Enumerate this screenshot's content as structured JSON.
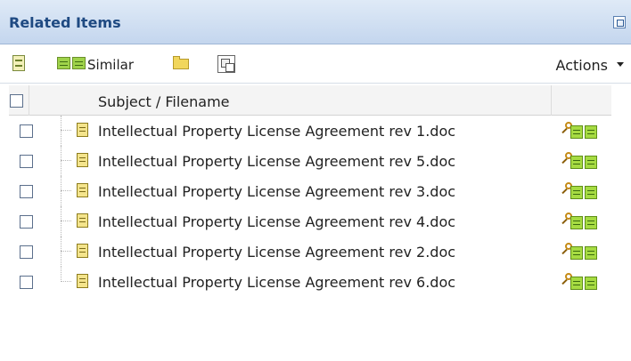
{
  "panel": {
    "title": "Related Items"
  },
  "toolbar": {
    "similar_label": "Similar",
    "actions_label": "Actions",
    "icons": [
      "list-view-icon",
      "similar-docs-icon",
      "folder-icon",
      "copy-icon",
      "popout-icon",
      "dropdown-caret-icon"
    ]
  },
  "table": {
    "header": {
      "subject_label": "Subject / Filename"
    },
    "rows": [
      {
        "filename": "Intellectual Property License Agreement rev 1.doc"
      },
      {
        "filename": "Intellectual Property License Agreement rev 5.doc"
      },
      {
        "filename": "Intellectual Property License Agreement rev 3.doc"
      },
      {
        "filename": "Intellectual Property License Agreement rev 4.doc"
      },
      {
        "filename": "Intellectual Property License Agreement rev 2.doc"
      },
      {
        "filename": "Intellectual Property License Agreement rev 6.doc"
      }
    ]
  },
  "colors": {
    "title_text": "#1f4a82",
    "titlebar_top": "#dfeaf7",
    "titlebar_bottom": "#c4d6ee",
    "background": "#7f9fc8"
  }
}
